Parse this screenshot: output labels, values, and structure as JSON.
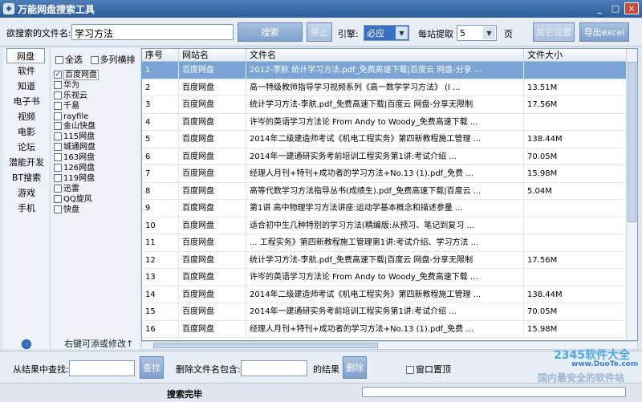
{
  "window": {
    "title": "万能网盘搜索工具",
    "minimize": "_",
    "maximize": "□",
    "close": "×"
  },
  "toolbar": {
    "filename_label": "欲搜索的文件名:",
    "filename_value": "学习方法",
    "search_button": "搜索",
    "stop_button": "停止",
    "engine_label": "引擎:",
    "engine_value": "必应",
    "per_site_label": "每站提取",
    "per_site_value": "5",
    "pages_label": "页",
    "other_settings_button": "其它设置",
    "export_button": "导出excel"
  },
  "categories": [
    {
      "label": "网盘",
      "selected": true
    },
    {
      "label": "软件"
    },
    {
      "label": "知道"
    },
    {
      "label": "电子书"
    },
    {
      "label": "视频"
    },
    {
      "label": "电影"
    },
    {
      "label": "论坛"
    },
    {
      "label": "潜能开发"
    },
    {
      "label": "BT搜索"
    },
    {
      "label": "游戏"
    },
    {
      "label": "手机"
    }
  ],
  "site_options": {
    "select_all": "全选",
    "multi_row": "多列横排"
  },
  "sites": [
    {
      "label": "百度网盘",
      "checked": true,
      "selected": true
    },
    {
      "label": "华为",
      "checked": false
    },
    {
      "label": "乐视云",
      "checked": false
    },
    {
      "label": "千易",
      "checked": false
    },
    {
      "label": "rayfile",
      "checked": false
    },
    {
      "label": "金山快盘",
      "checked": false
    },
    {
      "label": "115网盘",
      "checked": false
    },
    {
      "label": "城通网盘",
      "checked": false
    },
    {
      "label": "163网盘",
      "checked": false
    },
    {
      "label": "126网盘",
      "checked": false
    },
    {
      "label": "119网盘",
      "checked": false
    },
    {
      "label": "迅雷",
      "checked": false
    },
    {
      "label": "QQ旋风",
      "checked": false
    },
    {
      "label": "快盘",
      "checked": false
    }
  ],
  "hint": "右键可添或修改↑",
  "table": {
    "headers": [
      "序号",
      "网站名",
      "文件名",
      "文件大小"
    ],
    "rows": [
      [
        "1",
        "百度网盘",
        "2012-李航 统计学习方法.pdf_免费高速下载|百度云 网盘-分享 ...",
        ""
      ],
      [
        "2",
        "百度网盘",
        "高一特级教师指导学习视频系列《高一数学学习方法》 (l ...",
        "13.51M"
      ],
      [
        "3",
        "百度网盘",
        "统计学习方法-李航.pdf_免费高速下载|百度云 网盘-分享无限制",
        "17.56M"
      ],
      [
        "4",
        "百度网盘",
        "许岑的英语学习方法论 From Andy to Woody_免费高速下载 ...",
        ""
      ],
      [
        "5",
        "百度网盘",
        "2014年二级建造师考试《机电工程实务》第四新教程施工管理 ...",
        "138.44M"
      ],
      [
        "6",
        "百度网盘",
        "2014年一建通研实务考前培训工程实务第1讲:考试介绍 ...",
        "70.05M"
      ],
      [
        "7",
        "百度网盘",
        "经理人月刊+特刊+成功者的学习方法+No.13 (1).pdf_免费 ...",
        "15.98M"
      ],
      [
        "8",
        "百度网盘",
        "高等代数学习方法指导丛书(成绩生).pdf_免费高速下载|百度云 ...",
        "5.04M"
      ],
      [
        "9",
        "百度网盘",
        "第1讲 高中物理学习方法讲座:运动学基本概念和描述参量 ...",
        ""
      ],
      [
        "10",
        "百度网盘",
        "适合初中生几种特别的学习方法(精编版:从预习、笔记到复习 ...",
        ""
      ],
      [
        "11",
        "百度网盘",
        "... 工程实务》第四新教程施工管理第1讲:考试介绍、学习方法 ...",
        ""
      ],
      [
        "12",
        "百度网盘",
        "统计学习方法-李航.pdf_免费高速下载|百度云 网盘-分享无限制",
        "17.56M"
      ],
      [
        "13",
        "百度网盘",
        "许岑的英语学习方法论 From Andy to Woody_免费高速下载 ...",
        ""
      ],
      [
        "14",
        "百度网盘",
        "2014年二级建造师考试《机电工程实务》第四新教程施工管理 ...",
        "138.44M"
      ],
      [
        "15",
        "百度网盘",
        "2014年一建通研实务考前培训工程实务第1讲:考试介绍 ...",
        "70.05M"
      ],
      [
        "16",
        "百度网盘",
        "经理人月刊+特刊+成功者的学习方法+No.13 (1).pdf_免费 ...",
        "15.98M"
      ]
    ]
  },
  "filter": {
    "find_label": "从结果中查找:",
    "find_value": "",
    "find_button": "查找",
    "delete_label": "删除文件名包含:",
    "delete_value": "",
    "result_label": "的结果",
    "delete_button": "删除",
    "pin_label": "窗口置顶"
  },
  "status": {
    "text": "搜索完毕"
  },
  "watermarks": [
    "2345软件大全",
    "www.DuoTe.com",
    "国内最安全的软件站"
  ]
}
